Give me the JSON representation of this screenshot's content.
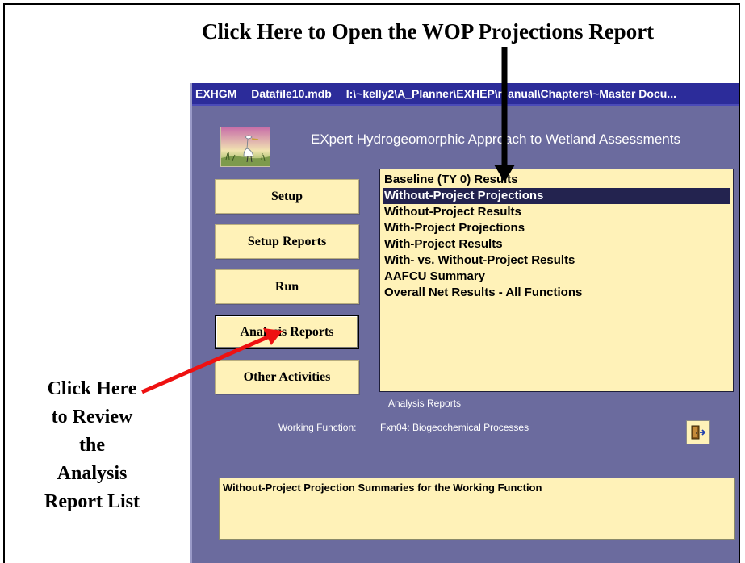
{
  "annotations": {
    "top_callout": "Click Here to Open the WOP Projections Report",
    "left_callout": [
      "Click Here",
      "to Review",
      "the",
      "Analysis",
      "Report List"
    ]
  },
  "window": {
    "title_parts": [
      "EXHGM",
      "Datafile10.mdb",
      "I:\\~kelly2\\A_Planner\\EXHEP\\manual\\Chapters\\~Master Docu..."
    ],
    "app_title": "EXpert Hydrogeomorphic Approach to Wetland Assessments",
    "logo_icon": "heron-wetland-logo-icon"
  },
  "nav": {
    "setup": "Setup",
    "setup_reports": "Setup Reports",
    "run": "Run",
    "analysis_reports": "Analysis Reports",
    "other_activities": "Other Activities"
  },
  "reports": {
    "items": [
      "Baseline (TY 0) Results",
      "Without-Project Projections",
      "Without-Project Results",
      "With-Project Projections",
      "With-Project Results",
      "With- vs. Without-Project Results",
      "AAFCU Summary",
      "Overall Net Results - All Functions"
    ],
    "selected_index": 1,
    "caption": "Analysis Reports"
  },
  "working_function": {
    "label": "Working Function:",
    "value": "Fxn04: Biogeochemical Processes"
  },
  "exit_button": {
    "icon": "exit-door-icon"
  },
  "description": "Without-Project Projection Summaries for the Working Function",
  "colors": {
    "window_bg": "#6b6b9e",
    "titlebar": "#2c2c9a",
    "button_bg": "#fff2b8",
    "selection": "#23234f",
    "arrow_black": "#000000",
    "arrow_red": "#ee1111"
  }
}
